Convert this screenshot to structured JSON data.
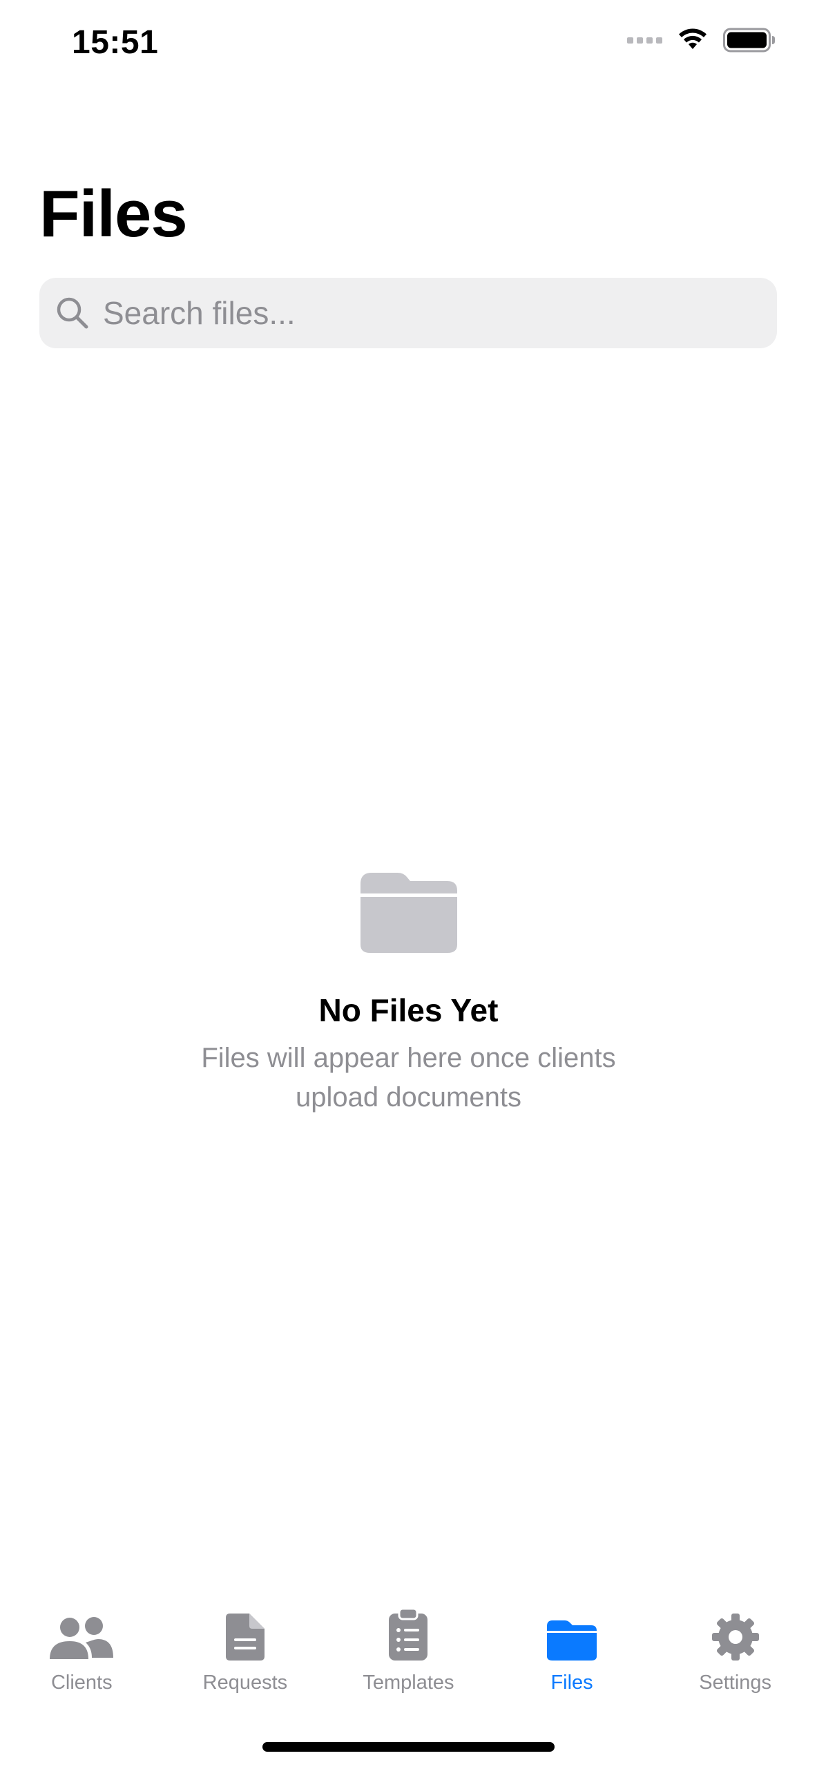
{
  "status_bar": {
    "time": "15:51",
    "icons": [
      "cellular-signal-icon",
      "wifi-icon",
      "battery-icon"
    ]
  },
  "header": {
    "title": "Files"
  },
  "search": {
    "placeholder": "Search files...",
    "value": "",
    "icon": "search-icon"
  },
  "empty_state": {
    "icon": "folder-icon",
    "title": "No Files Yet",
    "message": "Files will appear here once clients upload documents"
  },
  "tab_bar": {
    "active_tab": "Files",
    "active_color": "#0a7aff",
    "inactive_color": "#8e8e93",
    "tabs": [
      {
        "label": "Clients",
        "icon": "people-icon"
      },
      {
        "label": "Requests",
        "icon": "document-icon"
      },
      {
        "label": "Templates",
        "icon": "clipboard-icon"
      },
      {
        "label": "Files",
        "icon": "folder-icon"
      },
      {
        "label": "Settings",
        "icon": "gear-icon"
      }
    ]
  }
}
